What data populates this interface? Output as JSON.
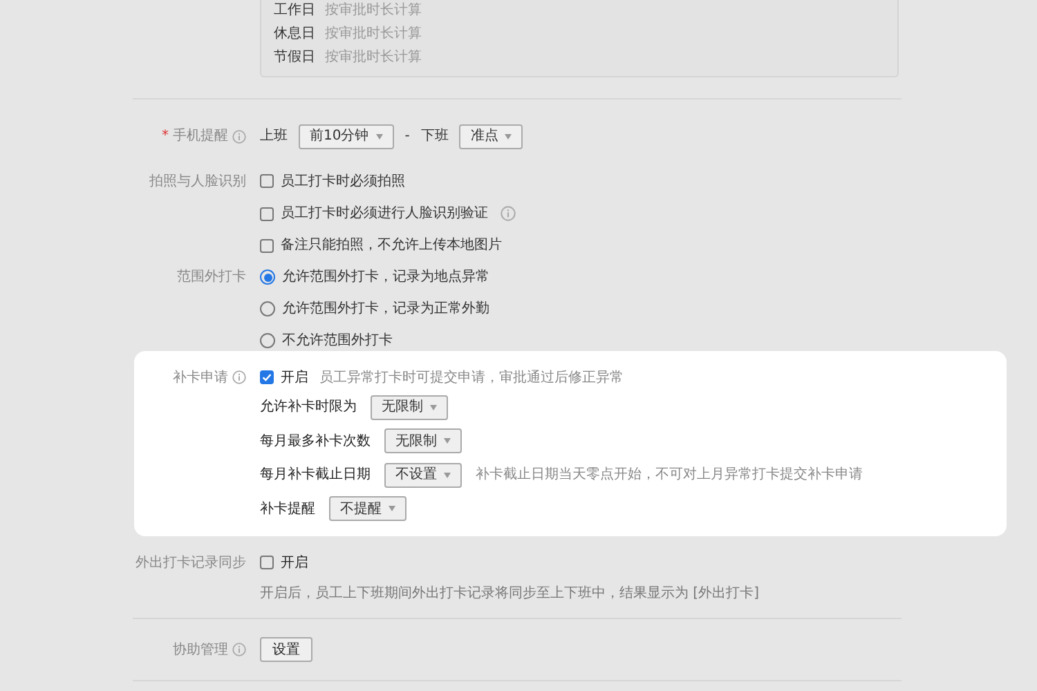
{
  "overtime_rules": [
    {
      "day": "工作日",
      "rule": "按审批时长计算"
    },
    {
      "day": "休息日",
      "rule": "按审批时长计算"
    },
    {
      "day": "节假日",
      "rule": "按审批时长计算"
    }
  ],
  "phone_reminder": {
    "marker": "*",
    "label": "手机提醒",
    "start_label": "上班",
    "start_value": "前10分钟",
    "separator": "-",
    "end_label": "下班",
    "end_value": "准点"
  },
  "photo_face": {
    "label": "拍照与人脸识别",
    "options": [
      {
        "label": "员工打卡时必须拍照",
        "checked": false,
        "info": false
      },
      {
        "label": "员工打卡时必须进行人脸识别验证",
        "checked": false,
        "info": true
      },
      {
        "label": "备注只能拍照，不允许上传本地图片",
        "checked": false,
        "info": false
      }
    ]
  },
  "out_of_range": {
    "label": "范围外打卡",
    "options": [
      {
        "label": "允许范围外打卡，记录为地点异常",
        "selected": true
      },
      {
        "label": "允许范围外打卡，记录为正常外勤",
        "selected": false
      },
      {
        "label": "不允许范围外打卡",
        "selected": false
      }
    ]
  },
  "makeup_request": {
    "label": "补卡申请",
    "highlighted": true,
    "checked": true,
    "toggle_label": "开启",
    "hint": "员工异常打卡时可提交申请，审批通过后修正异常",
    "settings": [
      {
        "label": "允许补卡时限为",
        "value": "无限制"
      },
      {
        "label": "每月最多补卡次数",
        "value": "无限制"
      },
      {
        "label": "每月补卡截止日期",
        "value": "不设置",
        "note": "补卡截止日期当天零点开始，不可对上月异常打卡提交补卡申请"
      },
      {
        "label": "补卡提醒",
        "value": "不提醒"
      }
    ]
  },
  "field_sync": {
    "label": "外出打卡记录同步",
    "checked": false,
    "toggle_label": "开启",
    "description": "开启后，员工上下班期间外出打卡记录将同步至上下班中，结果显示为 [外出打卡]"
  },
  "assist": {
    "label": "协助管理",
    "button": "设置"
  }
}
